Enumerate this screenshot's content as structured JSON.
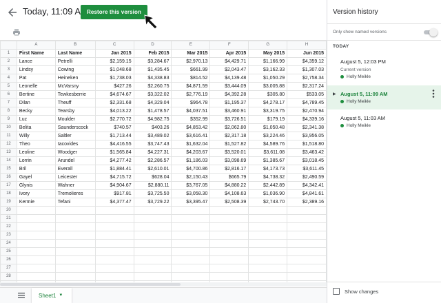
{
  "title": "Today, 11:09 AM",
  "restore_button": "Restore this version",
  "sheet": {
    "columns": [
      "A",
      "B",
      "C",
      "D",
      "E",
      "F",
      "G",
      "H"
    ],
    "header_row": [
      "First Name",
      "Last Name",
      "Jan 2015",
      "Feb 2015",
      "Mar 2015",
      "Apr 2015",
      "May 2015",
      "Jun 2015"
    ],
    "rows": [
      [
        "Lance",
        "Petrelli",
        "$2,159.15",
        "$3,284.67",
        "$2,970.13",
        "$4,429.71",
        "$1,166.99",
        "$4,359.12"
      ],
      [
        "Lindsy",
        "Cowing",
        "$1,048.68",
        "$1,435.45",
        "$661.99",
        "$2,043.47",
        "$3,162.33",
        "$1,307.03"
      ],
      [
        "Pat",
        "Heineken",
        "$1,738.03",
        "$4,338.83",
        "$814.52",
        "$4,139.48",
        "$1,050.29",
        "$2,758.34"
      ],
      [
        "Leonelle",
        "McVarsny",
        "$427.26",
        "$2,260.75",
        "$4,871.59",
        "$3,444.09",
        "$3,005.88",
        "$2,317.24"
      ],
      [
        "Bertine",
        "Tewkesberrie",
        "$4,674.67",
        "$3,322.02",
        "$2,776.19",
        "$4,392.28",
        "$305.80",
        "$533.05"
      ],
      [
        "Dilan",
        "Theuff",
        "$2,331.68",
        "$4,329.04",
        "$964.78",
        "$1,195.37",
        "$4,278.17",
        "$4,789.45"
      ],
      [
        "Becky",
        "Tearsby",
        "$4,013.22",
        "$1,478.57",
        "$4,037.51",
        "$3,460.91",
        "$3,319.75",
        "$2,470.94"
      ],
      [
        "Luz",
        "Moulder",
        "$2,770.72",
        "$4,982.75",
        "$352.99",
        "$3,726.51",
        "$179.19",
        "$4,339.16"
      ],
      [
        "Belita",
        "Saunderscock",
        "$740.57",
        "$403.26",
        "$4,853.42",
        "$2,062.80",
        "$1,050.48",
        "$2,341.38"
      ],
      [
        "Willy",
        "Saltler",
        "$1,713.44",
        "$3,489.02",
        "$3,616.41",
        "$2,317.18",
        "$3,224.46",
        "$3,956.05"
      ],
      [
        "Theo",
        "Iacovides",
        "$4,416.55",
        "$3,747.43",
        "$1,632.04",
        "$1,527.82",
        "$4,589.76",
        "$1,518.80"
      ],
      [
        "Leoline",
        "Woodger",
        "$1,565.84",
        "$4,227.31",
        "$4,203.67",
        "$3,520.01",
        "$3,611.08",
        "$3,463.42"
      ],
      [
        "Lorrin",
        "Arundel",
        "$4,277.42",
        "$2,286.57",
        "$1,186.03",
        "$3,098.69",
        "$1,385.67",
        "$3,018.45"
      ],
      [
        "Bril",
        "Everall",
        "$1,884.41",
        "$2,610.01",
        "$4,700.86",
        "$2,816.17",
        "$4,173.73",
        "$3,611.45"
      ],
      [
        "Gayel",
        "Leicester",
        "$4,715.72",
        "$628.04",
        "$2,150.43",
        "$665.79",
        "$4,738.32",
        "$2,490.59"
      ],
      [
        "Glynis",
        "Wahner",
        "$4,904.67",
        "$2,880.11",
        "$3,767.05",
        "$4,880.22",
        "$2,442.89",
        "$4,342.41"
      ],
      [
        "Ivory",
        "Tremolieres",
        "$917.81",
        "$3,725.50",
        "$3,058.30",
        "$4,108.63",
        "$1,036.90",
        "$4,841.61"
      ],
      [
        "Kermie",
        "Tefani",
        "$4,377.47",
        "$3,729.22",
        "$3,395.47",
        "$2,508.39",
        "$2,743.70",
        "$2,389.16"
      ]
    ],
    "total_rows": 30,
    "tab_name": "Sheet1"
  },
  "panel": {
    "title": "Version history",
    "only_named_label": "Only show named versions",
    "section": "TODAY",
    "versions": [
      {
        "date": "August 5, 12:03 PM",
        "sub": "Current version",
        "author": "Holly Meikle"
      },
      {
        "date": "August 5, 11:09 AM",
        "author": "Holly Meikle"
      },
      {
        "date": "August 5, 11:03 AM",
        "author": "Holly Meikle"
      }
    ],
    "show_changes_label": "Show changes"
  },
  "colors": {
    "accent": "#1e8e3e",
    "selected_bg": "#e6f4ea"
  }
}
